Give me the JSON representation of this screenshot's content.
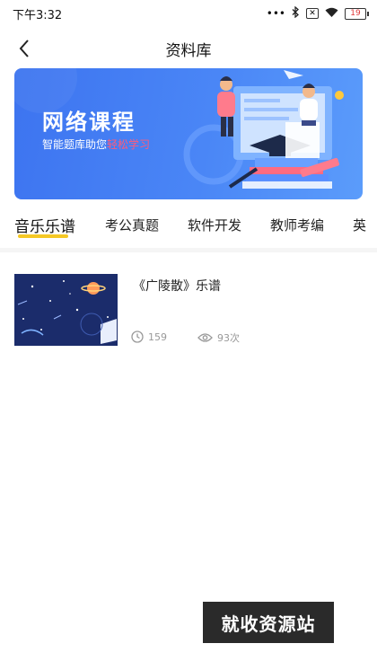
{
  "status_bar": {
    "time": "下午3:32",
    "signal": "•••",
    "battery": "19"
  },
  "header": {
    "title": "资料库"
  },
  "banner": {
    "title": "网络课程",
    "subtitle_prefix": "智能题库助您",
    "subtitle_highlight": "轻松学习"
  },
  "tabs": [
    {
      "label": "音乐乐谱",
      "active": true
    },
    {
      "label": "考公真题",
      "active": false
    },
    {
      "label": "软件开发",
      "active": false
    },
    {
      "label": "教师考编",
      "active": false
    },
    {
      "label": "英",
      "active": false
    }
  ],
  "items": [
    {
      "title": "《广陵散》乐谱",
      "duration": "159",
      "views": "93次"
    }
  ],
  "watermark": "就收资源站",
  "colors": {
    "tab_underline": "#f5c825",
    "banner_blue": "#4a86f6",
    "banner_highlight": "#ff5b7a"
  }
}
